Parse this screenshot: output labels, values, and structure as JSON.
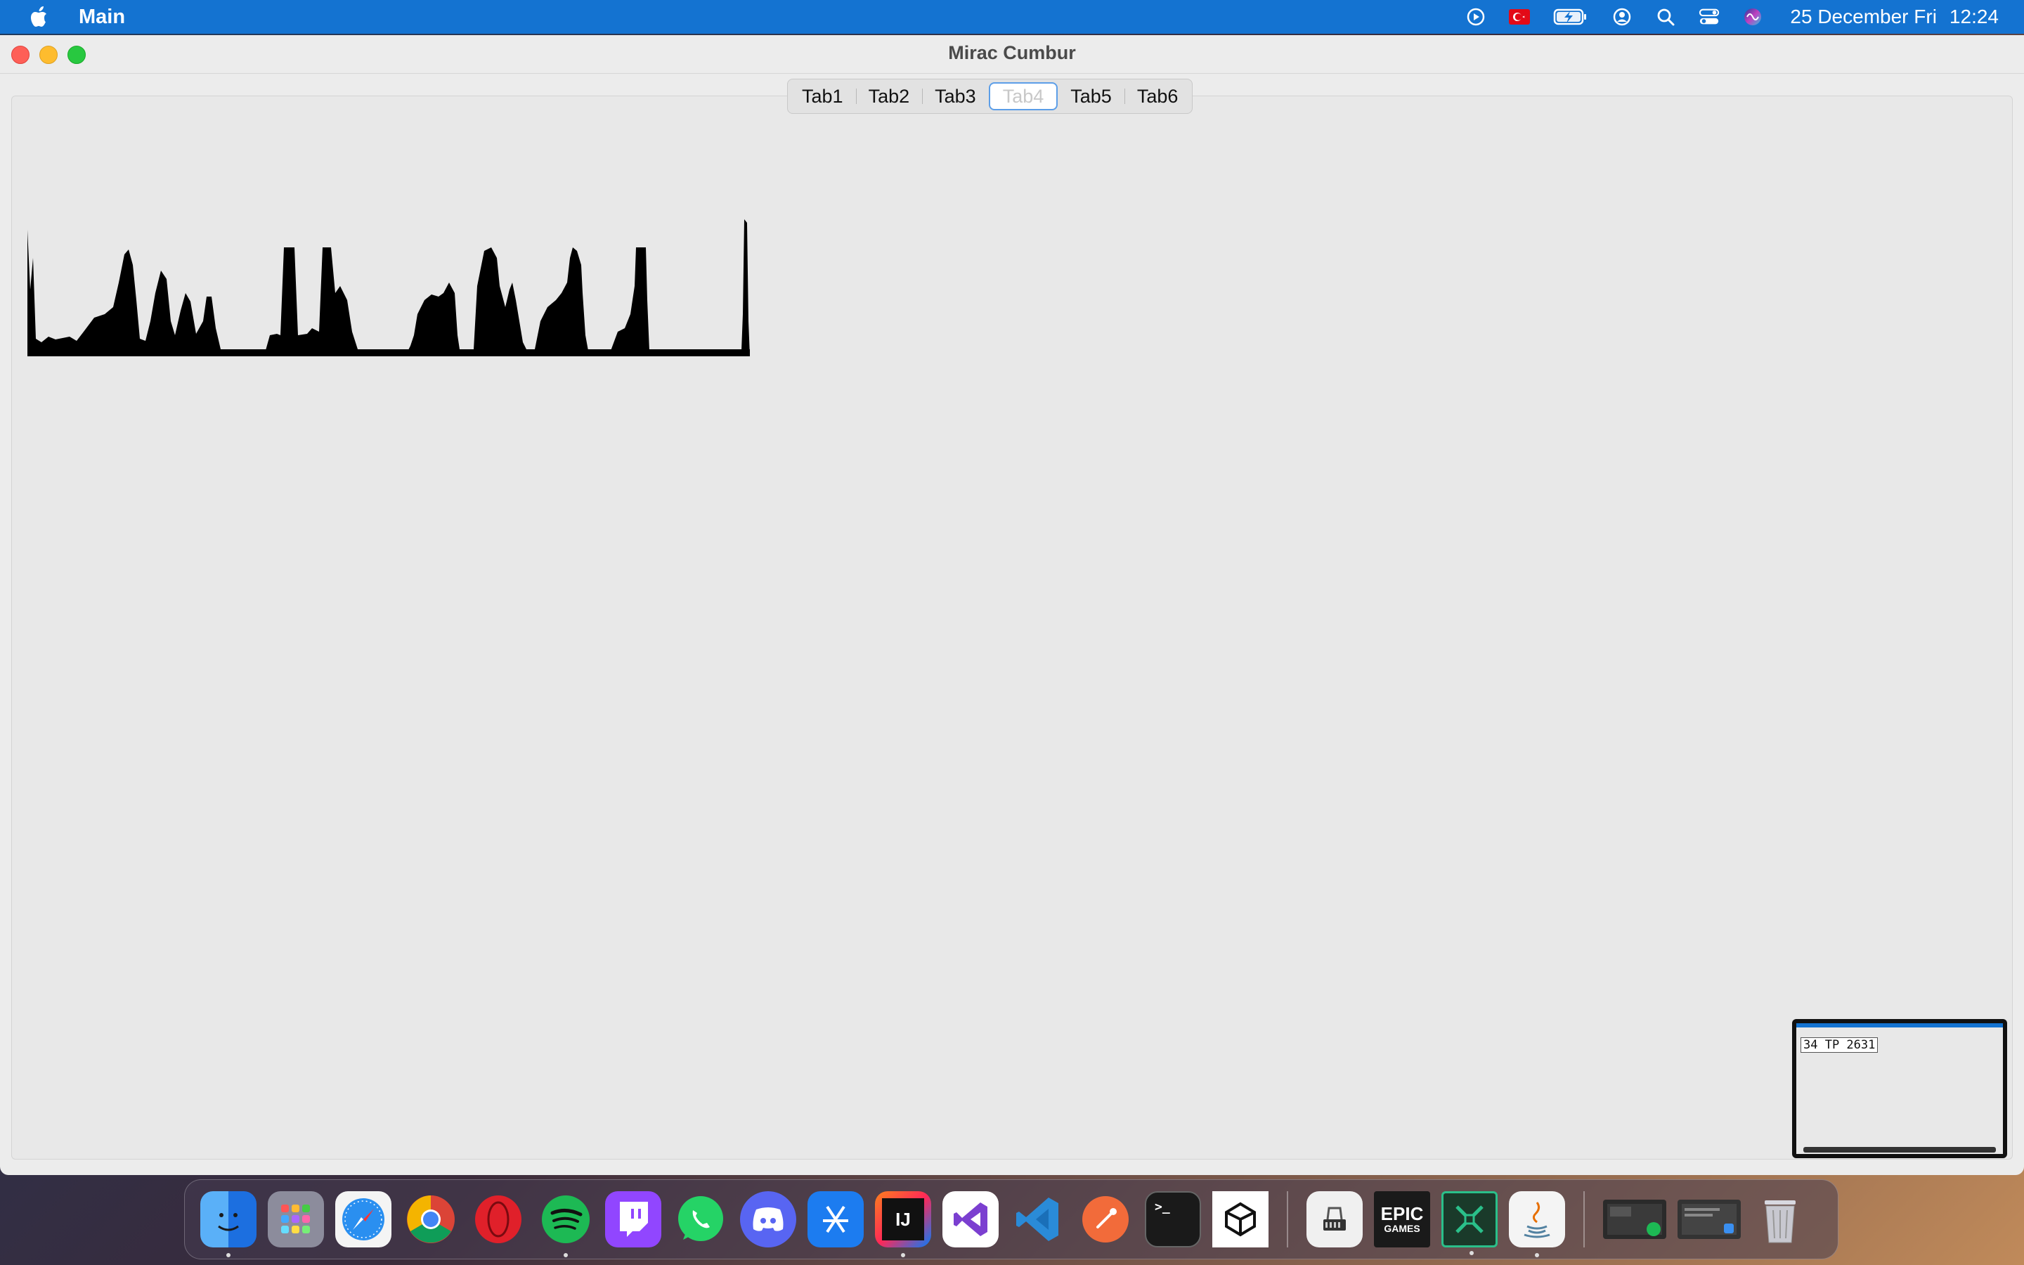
{
  "menubar": {
    "app_name": "Main",
    "date": "25 December Fri",
    "time": "12:24",
    "icons": [
      "play-circle-icon",
      "turkish-flag-icon",
      "battery-charging-icon",
      "user-account-icon",
      "search-icon",
      "control-center-icon",
      "siri-icon"
    ]
  },
  "window": {
    "title": "Mirac Cumbur"
  },
  "tabs": [
    {
      "label": "Tab1"
    },
    {
      "label": "Tab2"
    },
    {
      "label": "Tab3"
    },
    {
      "label": "Tab4",
      "active": true
    },
    {
      "label": "Tab5"
    },
    {
      "label": "Tab6"
    }
  ],
  "thumbnail": {
    "text": "34 TP 2631"
  },
  "dock": {
    "apps": [
      {
        "name": "finder",
        "color": "#3a8ff0"
      },
      {
        "name": "launchpad",
        "color": "#8a8a9a"
      },
      {
        "name": "safari",
        "color": "#2a7ff0"
      },
      {
        "name": "chrome",
        "color": "#e8e8e8"
      },
      {
        "name": "opera",
        "color": "#e0202a"
      },
      {
        "name": "spotify",
        "color": "#1db954"
      },
      {
        "name": "twitch",
        "color": "#9146ff"
      },
      {
        "name": "whatsapp",
        "color": "#25d366"
      },
      {
        "name": "discord",
        "color": "#5865f2"
      },
      {
        "name": "xcode",
        "color": "#1c7cf0"
      },
      {
        "name": "intellij-idea",
        "color": "#111111",
        "label": "IJ"
      },
      {
        "name": "visual-studio",
        "color": "#7b3fd0"
      },
      {
        "name": "vscode",
        "color": "#2a8bd8"
      },
      {
        "name": "postman",
        "color": "#f26b3a"
      },
      {
        "name": "terminal",
        "color": "#1a1a1a",
        "label": ">_"
      },
      {
        "name": "unity",
        "color": "#ffffff"
      },
      {
        "name": "system-information",
        "color": "#dcdcdc"
      },
      {
        "name": "epic-games",
        "color": "#1a1a1a",
        "label": "EPIC GAMES"
      },
      {
        "name": "app-green",
        "color": "#1a3a2a"
      },
      {
        "name": "java",
        "color": "#f0f0f0"
      },
      {
        "name": "recent-window-1",
        "color": "#2a2a2a"
      },
      {
        "name": "recent-window-2",
        "color": "#3a3a3a"
      },
      {
        "name": "trash",
        "color": "#c8c8d0"
      }
    ]
  }
}
